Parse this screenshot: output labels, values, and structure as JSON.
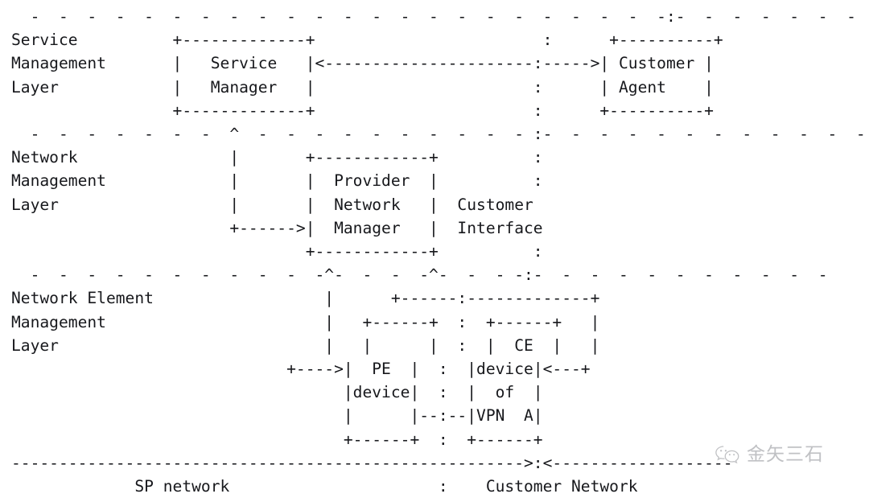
{
  "document": {
    "kind": "ascii-art-diagram",
    "title": "Layered VPN service management reference model",
    "background_color": "#ffffff",
    "text_color": "#17181c"
  },
  "layers": [
    {
      "id": "service-management",
      "lines": [
        "Service",
        "Management",
        "Layer"
      ]
    },
    {
      "id": "network-management",
      "lines": [
        "Network",
        "Management",
        "Layer"
      ]
    },
    {
      "id": "network-element-management",
      "lines": [
        "Network Element",
        "Management",
        "Layer"
      ]
    }
  ],
  "boxes": [
    {
      "id": "service-manager",
      "lines": [
        "Service",
        "Manager"
      ]
    },
    {
      "id": "customer-agent",
      "lines": [
        "Customer",
        "Agent"
      ]
    },
    {
      "id": "provider-network-manager",
      "lines": [
        "Provider",
        "Network",
        "Manager"
      ]
    },
    {
      "id": "pe-device",
      "lines": [
        "PE",
        "device"
      ]
    },
    {
      "id": "ce-device",
      "lines": [
        "CE",
        "device",
        "of",
        "VPN  A"
      ]
    }
  ],
  "labels": {
    "customer_interface": [
      "Customer",
      "Interface"
    ],
    "sp_network": "SP network",
    "customer_network": "Customer Network"
  },
  "watermark": {
    "text": "金矢三石",
    "logo": "wechat-icon",
    "color": "#8d8f94"
  },
  "ascii": "  -  -  -  -  -  -  -  -  -  -  -  -  -  -  -  -  -  -  -  -  -  -  -:-  -  -  -  -  -  -  -  -  -\nService          +-------------+                        :      +----------+\nManagement       |   Service   |<----------------------:----->| Customer |\nLayer            |   Manager   |                       :      | Agent    |\n                 +-------------+                       :      +----------+\n  -  -  -  -  -  -  -  ^  -  -  -  -  -  -  -  -  -  - :-  -  -  -  -  -  -  -  -  -  -  -\nNetwork                |       +------------+          :\nManagement             |       |  Provider  |          :\nLayer                  |       |  Network   |  Customer\n                       +------>|  Manager   |  Interface\n                               +------------+          :\n  -  -  -  -  -  -  -  -  -  -  -^-  -  -  -^-  -  - -:-  -  -  -  -  -  -  -  -  -  -\nNetwork Element                  |      +------:-------------+\nManagement                       |   +------+  :  +------+   |\nLayer                            |   |      |  :  |  CE  |   |\n                             +---->|  PE  |  :  |device|<---+\n                                   |device|  :  |  of  |\n                                   |      |--:--|VPN  A|\n                                   +------+  :  +------+\n------------------------------------------------------>:<-------------------\n             SP network                      :    Customer Network"
}
